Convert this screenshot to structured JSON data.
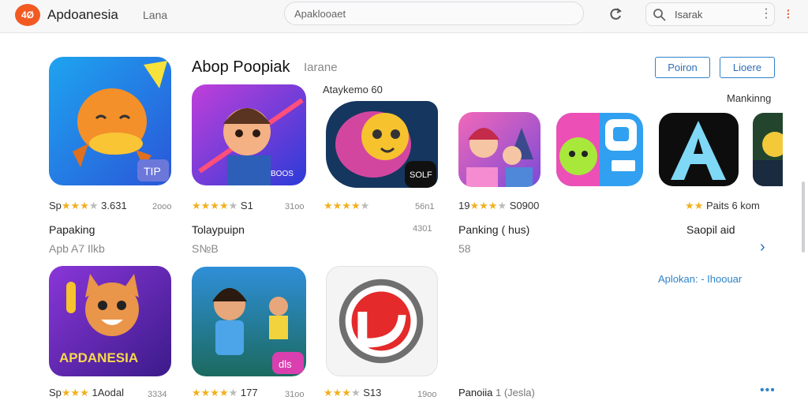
{
  "header": {
    "logo_text": "4Ø",
    "brand": "Apdoanesia",
    "brand_sub": "Lana",
    "center_search": "Apaklooaet",
    "search_text": "Isarak",
    "menu_dots": "⋮",
    "close": "⁝"
  },
  "section": {
    "title": "Abop Poopiak",
    "title_sub": "Iarane",
    "tab1": "Poiron",
    "tab2": "Lioere",
    "label_top": "Ataykemo 60",
    "label_ranking": "Mankinng"
  },
  "apps": [
    {
      "stars": "Sp",
      "rating": "3.631",
      "meta": "2ooo",
      "name": "Papaking",
      "sub": "Apb A7 Ilkb",
      "badge": "TIP"
    },
    {
      "stars": "",
      "rating": "S1",
      "meta": "31oo",
      "name": "Tolaypuipn",
      "sub": "S№B",
      "badge": "BOOS"
    },
    {
      "stars": "",
      "rating": "",
      "meta": "56n1",
      "name": "",
      "sub": "",
      "extra": "4301",
      "badge": "SOLF"
    },
    {
      "stars": "19",
      "rating": "S0900",
      "meta": "",
      "name": "Panking ( hus)",
      "sub": "58",
      "badge": ""
    },
    {
      "stars": "",
      "rating": "Paits 6 kom",
      "name": "Saopil aid",
      "badge": ""
    }
  ],
  "row2": [
    {
      "stars": "Sp",
      "rating": "1Aodal",
      "meta": "3334",
      "label": "APDANESIA"
    },
    {
      "stars": "",
      "rating": "177",
      "meta": "31oo",
      "badge": "dls"
    },
    {
      "stars": "",
      "rating": "S13",
      "meta": "19oo"
    },
    {
      "name": "Panoiia",
      "extra": "1 (Jesla)"
    }
  ],
  "link": "Aplokan: - Ihoouar",
  "chevron": "›",
  "more": "•••"
}
